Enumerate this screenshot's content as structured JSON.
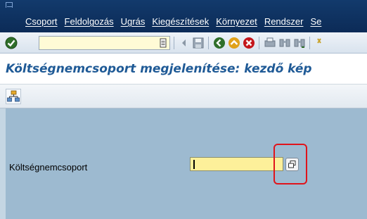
{
  "menu": {
    "items": [
      "Csoport",
      "Feldolgozás",
      "Ugrás",
      "Kiegészítések",
      "Környezet",
      "Rendszer",
      "Se"
    ]
  },
  "toolbar": {
    "command_field_value": "",
    "icons": [
      "enter-icon",
      "dropdown-icon",
      "back-arrow-icon",
      "save-icon",
      "back-icon",
      "exit-icon",
      "cancel-icon",
      "print-icon",
      "find-icon",
      "find-next-icon",
      "settings-icon"
    ]
  },
  "title": {
    "text": "Költségnemcsoport megjelenítése: kezdő kép"
  },
  "app_toolbar": {
    "icons": [
      "hierarchy-icon"
    ]
  },
  "form": {
    "label": "Költségnemcsoport",
    "value": ""
  },
  "colors": {
    "menubar": "#0c2b57",
    "title": "#1f5a96",
    "body": "#9dbad0",
    "input": "#fdf09a",
    "highlight": "#e0141b"
  }
}
